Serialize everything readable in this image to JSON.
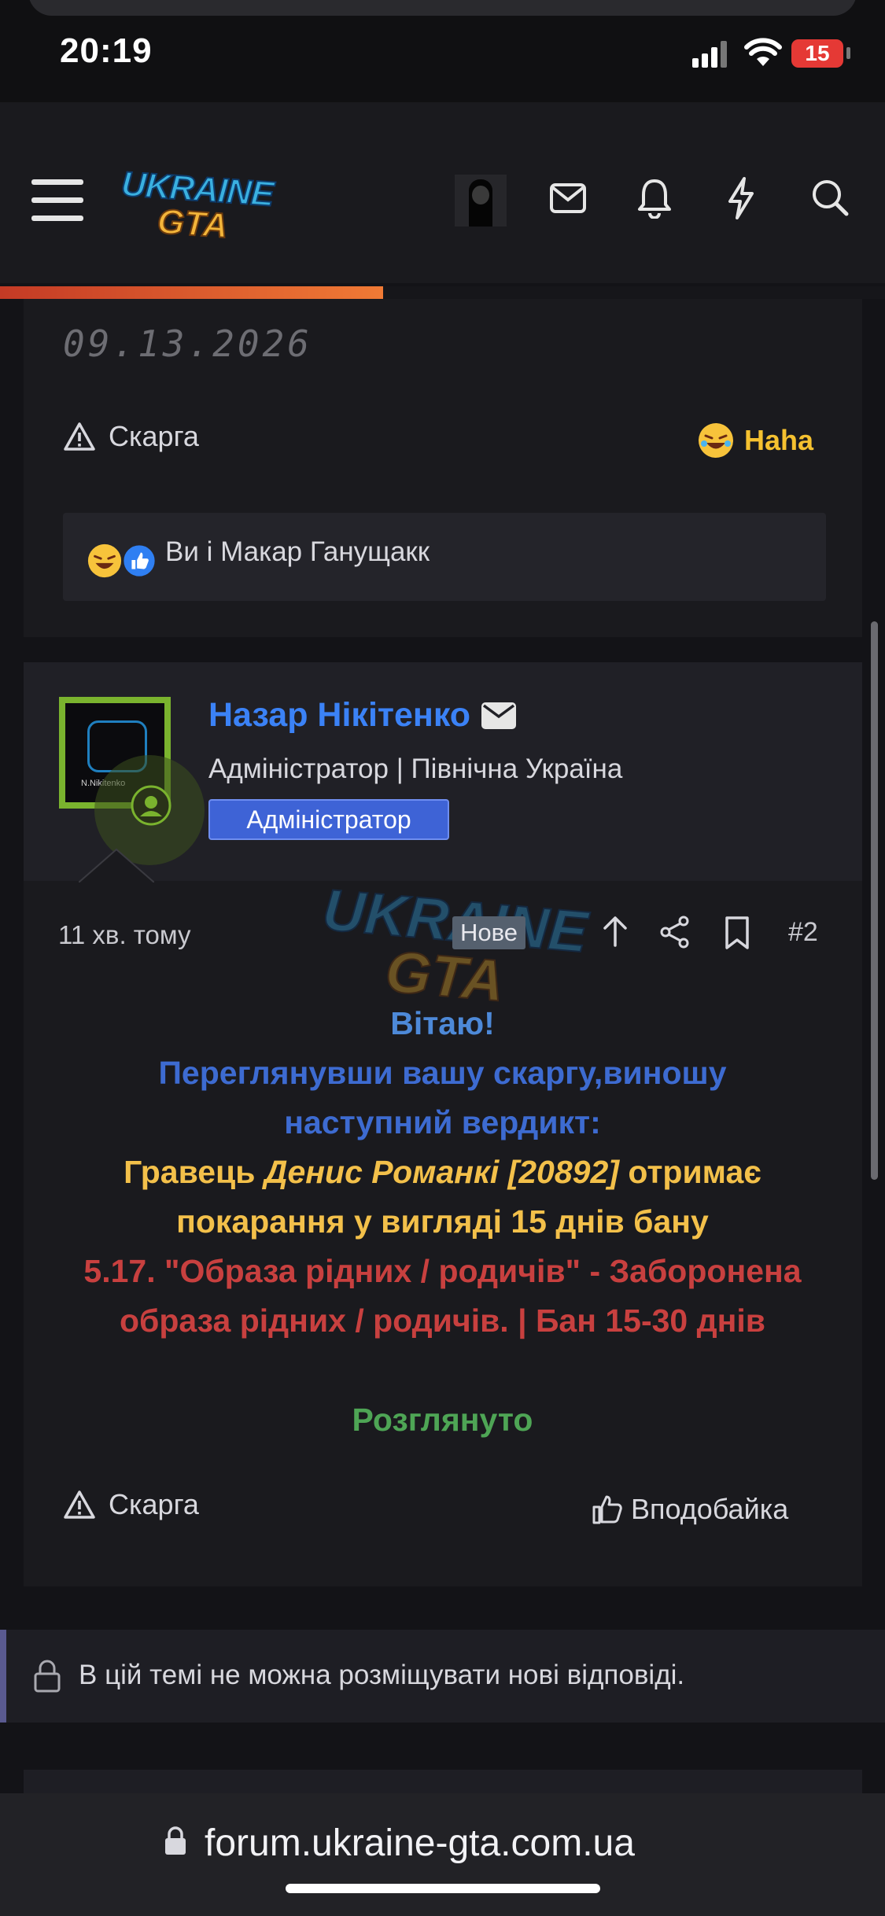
{
  "status_bar": {
    "time": "20:19",
    "battery": "15"
  },
  "header": {
    "logo_line1": "UKRAINE",
    "logo_line2": "GTA"
  },
  "prev_post": {
    "date": "09.13.2026",
    "report_label": "Скарга",
    "reaction_label": "Haha",
    "reactions_text": "Ви і Макар Ганущакк"
  },
  "post": {
    "author_name": "Назар Нікітенко",
    "author_title": "Адміністратор | Північна Україна",
    "badge": "Адміністратор",
    "avatar_text": "N.Nikitenko",
    "time_ago": "11 хв. тому",
    "new_badge": "Нове",
    "post_number": "#2",
    "watermark_line1": "UKRAINE",
    "watermark_line2": "GTA",
    "greeting": "Вітаю!",
    "line_blue": "Переглянувши вашу скаргу,виношу наступний вердикт:",
    "verdict_prefix": "Гравець",
    "verdict_name": "Денис Романкі [20892]",
    "verdict_suffix": "отримає покарання у вигляді 15 днів бану",
    "rule_text": "5.17. \"Образа рідних / родичів\" - Заборонена образа рідних / родичів. | Бан 15-30 днів",
    "status_text": "Розглянуто",
    "report_label": "Скарга",
    "like_label": "Вподобайка"
  },
  "locked_notice": "В цій темі не можна розміщувати нові відповіді.",
  "url": "forum.ukraine-gta.com.ua",
  "colors": {
    "author": "#3b82f6",
    "blue_text": "#3d6bd1",
    "greeting": "#4d89d8",
    "yellow": "#f3c04a",
    "red": "#c8403f",
    "green": "#4ea555",
    "badge_bg": "#3e63d6",
    "haha": "#f5c130"
  }
}
